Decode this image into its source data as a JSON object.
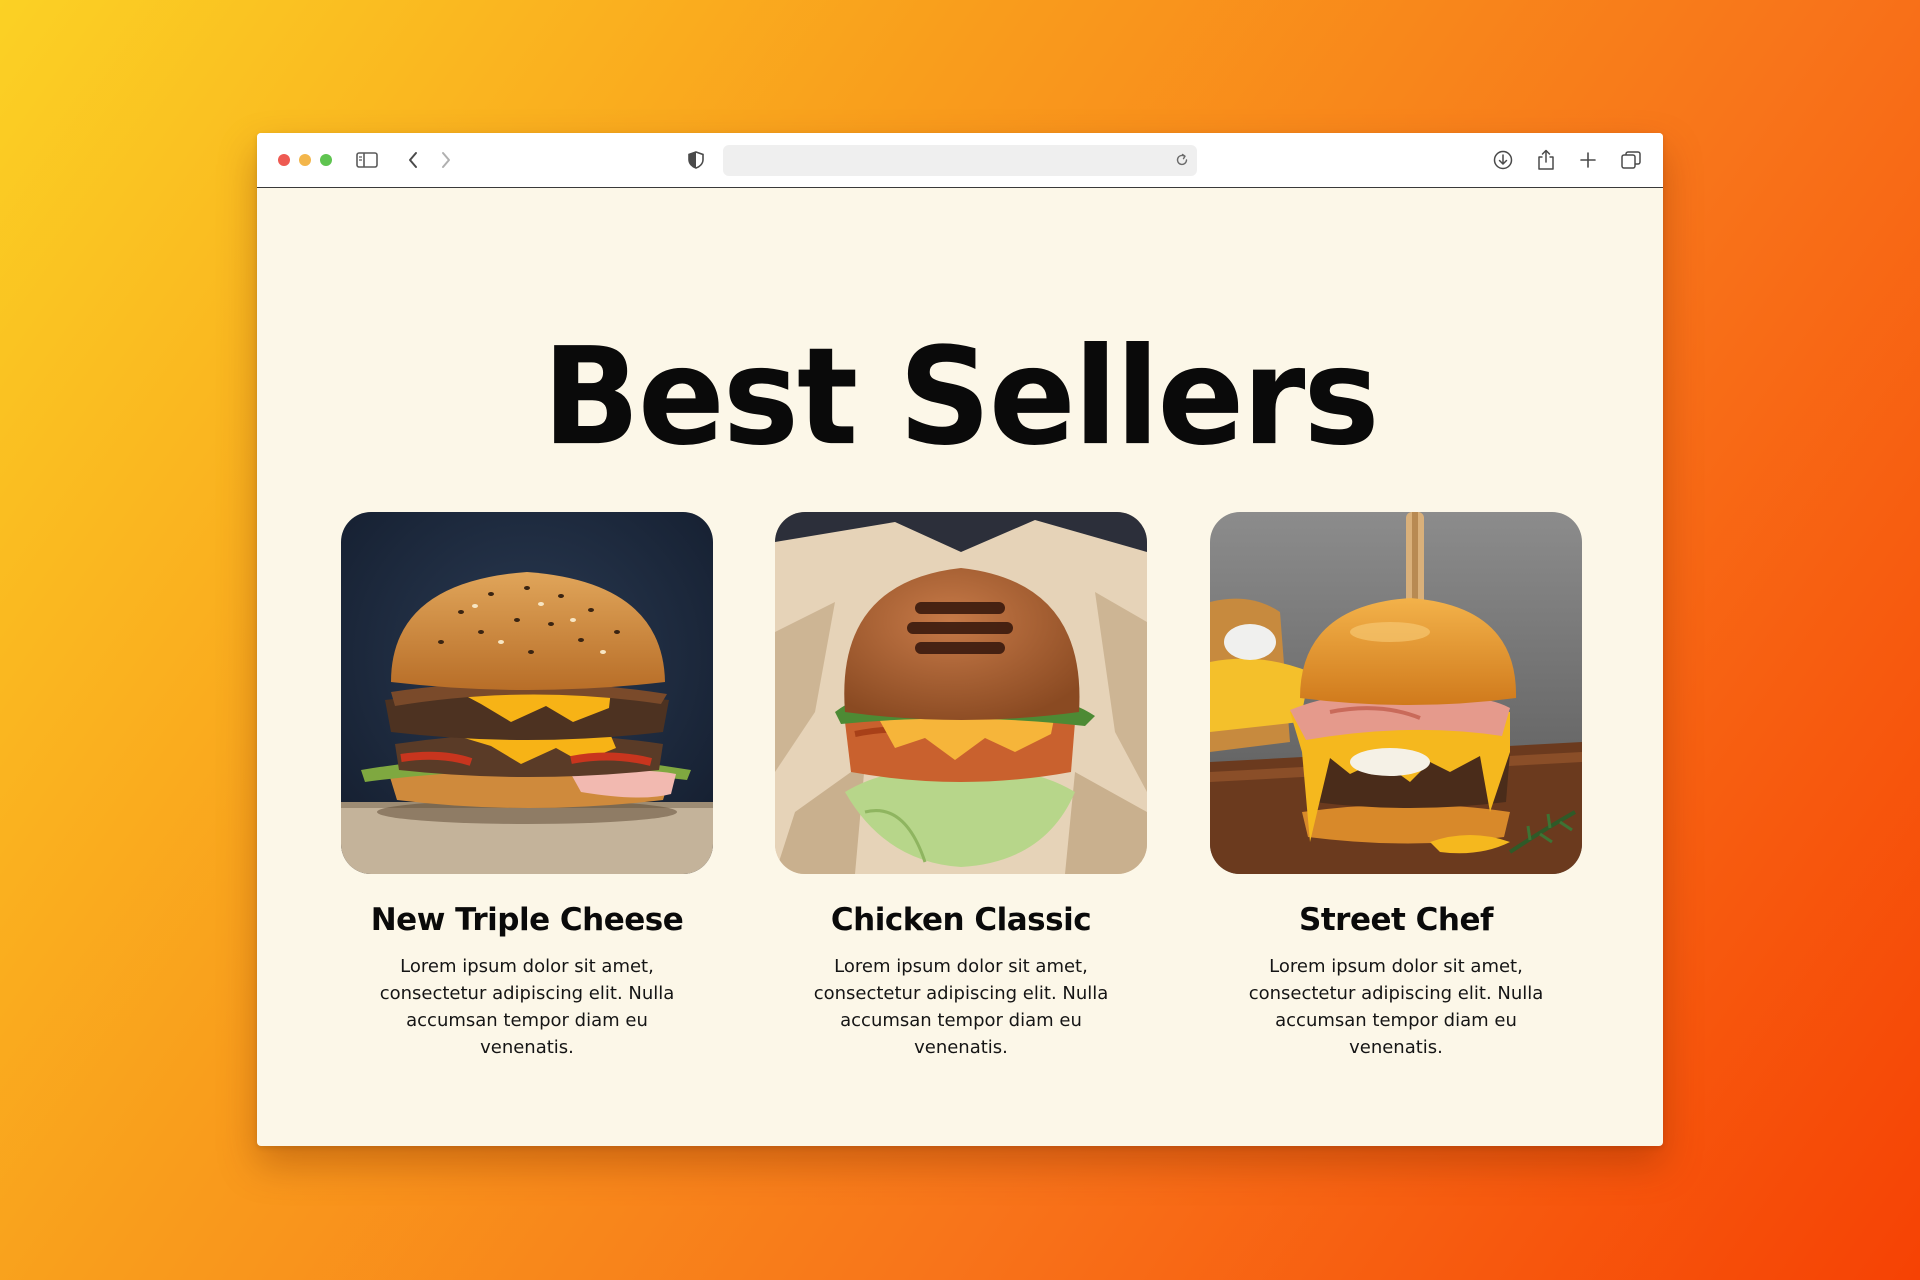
{
  "browser": {
    "address_value": "",
    "icons": {
      "sidebar": "sidebar-icon",
      "back": "chevron-left-icon",
      "forward": "chevron-right-icon",
      "privacy": "shield-icon",
      "reload": "reload-icon",
      "download": "download-icon",
      "share": "share-icon",
      "new_tab": "plus-icon",
      "tabs": "tabs-overview-icon"
    }
  },
  "page": {
    "title": "Best Sellers",
    "background_color": "#fcf7e8",
    "products": [
      {
        "name": "New Triple Cheese",
        "description": "Lorem ipsum dolor sit amet, consectetur adipiscing elit. Nulla accumsan tempor diam eu venenatis.",
        "image": "burger-photo"
      },
      {
        "name": "Chicken Classic",
        "description": "Lorem ipsum dolor sit amet, consectetur adipiscing elit. Nulla accumsan tempor diam eu venenatis.",
        "image": "burger-photo"
      },
      {
        "name": "Street Chef",
        "description": "Lorem ipsum dolor sit amet, consectetur adipiscing elit. Nulla accumsan tempor diam eu venenatis.",
        "image": "burger-photo"
      }
    ]
  }
}
